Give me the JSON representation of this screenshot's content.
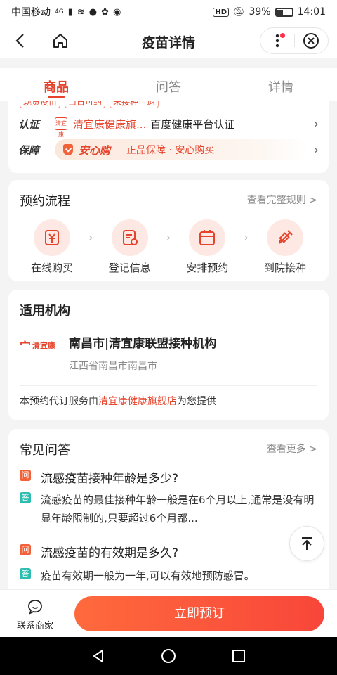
{
  "status_bar": {
    "carrier": "中国移动",
    "network": "4G",
    "battery": "39%",
    "time": "14:01",
    "hd": "HD"
  },
  "nav": {
    "title": "疫苗详情"
  },
  "tabs": [
    {
      "label": "商品"
    },
    {
      "label": "问答"
    },
    {
      "label": "详情"
    }
  ],
  "features": {
    "tags": [
      "现货疫苗",
      "当日可约",
      "未接种可退"
    ]
  },
  "cert": {
    "label": "认证",
    "shop_logo": "清宜康",
    "shop": "清宜康健康旗...",
    "text": "百度健康平台认证"
  },
  "guarantee": {
    "label": "保障",
    "name": "安心购",
    "text": "正品保障 · 安心购买"
  },
  "process": {
    "title": "预约流程",
    "link": "查看完整规则 >",
    "steps": [
      {
        "label": "在线购买"
      },
      {
        "label": "登记信息"
      },
      {
        "label": "安排预约"
      },
      {
        "label": "到院接种"
      }
    ]
  },
  "institution": {
    "title": "适用机构",
    "logo_mark": "宀",
    "logo_text": "清宜康",
    "name": "南昌市|清宜康联盟接种机构",
    "address": "江西省南昌市南昌市",
    "service_prefix": "本预约代订服务由",
    "service_shop": "清宜康健康旗舰店",
    "service_suffix": "为您提供"
  },
  "faq": {
    "title": "常见问答",
    "link": "查看更多 >",
    "q_badge": "问",
    "a_badge": "答",
    "items": [
      {
        "q": "流感疫苗接种年龄是多少?",
        "a": "流感疫苗的最佳接种年龄一般是在6个月以上,通常是没有明显年龄限制的,只要超过6个月都..."
      },
      {
        "q": "流感疫苗的有效期是多久?",
        "a": "疫苗有效期一般为一年,可以有效地预防感冒。"
      }
    ]
  },
  "bottom": {
    "contact": "联系商家",
    "buy": "立即预订"
  },
  "colors": {
    "accent": "#e5432b",
    "answer_badge": "#2cbdb0",
    "button": "#f8463a"
  }
}
